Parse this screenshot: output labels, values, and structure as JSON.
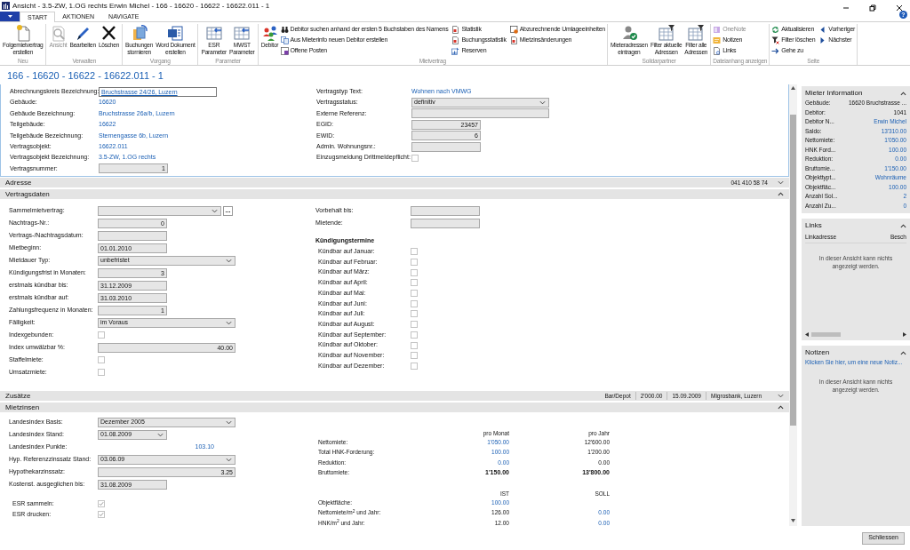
{
  "window": {
    "title": "Ansicht - 3.5-ZW, 1.OG rechts Erwin Michel - 166 - 16620 - 16622 - 16622.011 - 1",
    "help": "?"
  },
  "ribbon": {
    "tabs": [
      {
        "label": "START",
        "selected": true
      },
      {
        "label": "AKTIONEN",
        "selected": false
      },
      {
        "label": "NAVIGATE",
        "selected": false
      }
    ],
    "groups": [
      {
        "label": "Neu",
        "items": [
          {
            "label": "Folgemietvertrag\nerstellen",
            "kind": "large",
            "disabled": false
          }
        ]
      },
      {
        "label": "Verwalten",
        "items": [
          {
            "label": "Ansicht",
            "kind": "large",
            "disabled": true
          },
          {
            "label": "Bearbeiten",
            "kind": "large",
            "disabled": false
          },
          {
            "label": "Löschen",
            "kind": "large",
            "disabled": false
          }
        ]
      },
      {
        "label": "Vorgang",
        "items": [
          {
            "label": "Buchungen\nstornieren",
            "kind": "large",
            "disabled": false
          },
          {
            "label": "Word Dokument\nerstellen",
            "kind": "large",
            "disabled": false
          }
        ]
      },
      {
        "label": "Parameter",
        "items": [
          {
            "label": "ESR\nParameter",
            "kind": "large",
            "disabled": false
          },
          {
            "label": "MWST\nParameter",
            "kind": "large",
            "disabled": false
          }
        ]
      },
      {
        "label": "Mietvertrag",
        "items": [
          {
            "label": "Debitor",
            "kind": "large",
            "disabled": false
          },
          {
            "label": "Debitor suchen anhand der ersten 5 Buchstaben des Namens",
            "kind": "small",
            "disabled": false
          },
          {
            "label": "Aus Mieterinfo neuen Debitor erstellen",
            "kind": "small",
            "disabled": false
          },
          {
            "label": "Offene Posten",
            "kind": "small",
            "disabled": false
          },
          {
            "label": "Statistik",
            "kind": "small",
            "disabled": false
          },
          {
            "label": "Buchungsstatistik",
            "kind": "small",
            "disabled": false
          },
          {
            "label": "Reserven",
            "kind": "small",
            "disabled": false
          },
          {
            "label": "Abzurechnende Umlageeinheiten",
            "kind": "small",
            "disabled": false
          },
          {
            "label": "Mietzinsänderungen",
            "kind": "small",
            "disabled": false
          }
        ]
      },
      {
        "label": "Solidarpartner",
        "items": [
          {
            "label": "Mieteradressen\neintragen",
            "kind": "large",
            "disabled": false
          },
          {
            "label": "Filter aktuelle\nAdressen",
            "kind": "large",
            "disabled": false
          },
          {
            "label": "Filter alle\nAdressen",
            "kind": "large",
            "disabled": false
          }
        ]
      },
      {
        "label": "Dateianhang anzeigen",
        "items": [
          {
            "label": "OneNote",
            "kind": "small",
            "disabled": true
          },
          {
            "label": "Notizen",
            "kind": "small",
            "disabled": false
          },
          {
            "label": "Links",
            "kind": "small",
            "disabled": false
          }
        ]
      },
      {
        "label": "Seite",
        "items": [
          {
            "label": "Aktualisieren",
            "kind": "small",
            "disabled": false
          },
          {
            "label": "Filter löschen",
            "kind": "small",
            "disabled": false
          },
          {
            "label": "Gehe zu",
            "kind": "small",
            "disabled": false
          },
          {
            "label": "Vorheriger",
            "kind": "small",
            "disabled": false
          },
          {
            "label": "Nächster",
            "kind": "small",
            "disabled": false
          }
        ]
      }
    ]
  },
  "heading": "166 - 16620 - 16622 - 16622.011 - 1",
  "general": {
    "left": [
      {
        "label": "Abrechnungskreis Bezeichnung:",
        "kind": "link",
        "value": "Bruchstrasse 24/26, Luzern"
      },
      {
        "label": "Gebäude:",
        "kind": "value",
        "value": "16620"
      },
      {
        "label": "Gebäude Bezeichnung:",
        "kind": "value",
        "value": "Bruchstrasse 26a/b, Luzern"
      },
      {
        "label": "Teilgebäude:",
        "kind": "value",
        "value": "16622"
      },
      {
        "label": "Teilgebäude Bezeichnung:",
        "kind": "value",
        "value": "Sternengasse 6b, Luzern"
      },
      {
        "label": "Vertragsobjekt:",
        "kind": "value",
        "value": "16622.011"
      },
      {
        "label": "Vertragsobjekt Bezeichnung:",
        "kind": "value",
        "value": "3.5-ZW, 1.OG rechts"
      },
      {
        "label": "Vertragsnummer:",
        "kind": "number",
        "value": "1"
      }
    ],
    "right": [
      {
        "label": "Vertragstyp Text:",
        "kind": "value",
        "value": "Wohnen nach VMWG"
      },
      {
        "label": "Vertragsstatus:",
        "kind": "select",
        "value": "definitiv"
      },
      {
        "label": "Externe Referenz:",
        "kind": "wide-input"
      },
      {
        "label": "EGID:",
        "kind": "number",
        "value": "23457"
      },
      {
        "label": "EWID:",
        "kind": "number",
        "value": "6"
      },
      {
        "label": "Admin. Wohnungsnr.:",
        "kind": "input"
      },
      {
        "label": "Einzugsmeldung Drittmeldepflicht:",
        "kind": "checkbox",
        "checked": false
      }
    ]
  },
  "sections": [
    {
      "title": "Adresse",
      "expanded": false,
      "summary": [
        "041 410 58 74"
      ]
    },
    {
      "title": "Vertragsdaten",
      "expanded": true,
      "left": [
        {
          "label": "Sammelmietvertrag:",
          "kind": "picker",
          "button": "..."
        },
        {
          "label": "Nachtrags-Nr.:",
          "kind": "number",
          "value": "0"
        },
        {
          "label": "Vertrags-/Nachtragsdatum:",
          "kind": "input"
        },
        {
          "label": "Mietbeginn:",
          "kind": "input",
          "value": "01.01.2010"
        },
        {
          "label": "Mietdauer Typ:",
          "kind": "select",
          "value": "unbefristet"
        },
        {
          "label": "Kündigungsfrist in Monaten:",
          "kind": "number",
          "value": "3"
        },
        {
          "label": "erstmals kündbar bis:",
          "kind": "input",
          "value": "31.12.2009"
        },
        {
          "label": "erstmals kündbar auf:",
          "kind": "input",
          "value": "31.03.2010"
        },
        {
          "label": "Zahlungsfrequenz in Monaten:",
          "kind": "number",
          "value": "1"
        },
        {
          "label": "Fälligkeit:",
          "kind": "select",
          "value": "im Voraus"
        },
        {
          "label": "Indexgebunden:",
          "kind": "checkbox",
          "checked": false
        },
        {
          "label": "Index umwälzbar %:",
          "kind": "wide-number",
          "value": "40.00"
        },
        {
          "label": "Staffelmiete:",
          "kind": "checkbox",
          "checked": false
        },
        {
          "label": "Umsatzmiete:",
          "kind": "checkbox",
          "checked": false
        }
      ],
      "right": [
        {
          "label": "Vorbehalt bis:",
          "kind": "input"
        },
        {
          "label": "Mietende:",
          "kind": "input"
        }
      ],
      "termine_title": "Kündigungstermine",
      "termine": [
        {
          "label": "Kündbar auf Januar:",
          "checked": false
        },
        {
          "label": "Kündbar auf Februar:",
          "checked": false
        },
        {
          "label": "Kündbar auf März:",
          "checked": false
        },
        {
          "label": "Kündbar auf April:",
          "checked": false
        },
        {
          "label": "Kündbar auf Mai:",
          "checked": false
        },
        {
          "label": "Kündbar auf Juni:",
          "checked": false
        },
        {
          "label": "Kündbar auf Juli:",
          "checked": false
        },
        {
          "label": "Kündbar auf August:",
          "checked": false
        },
        {
          "label": "Kündbar auf September:",
          "checked": false
        },
        {
          "label": "Kündbar auf Oktober:",
          "checked": false
        },
        {
          "label": "Kündbar auf November:",
          "checked": false
        },
        {
          "label": "Kündbar auf Dezember:",
          "checked": false
        }
      ]
    },
    {
      "title": "Zusätze",
      "expanded": false,
      "summary": [
        "Bar/Depot",
        "2'000.00",
        "15.09.2009",
        "Migrosbank, Luzern"
      ]
    },
    {
      "title": "Mietzinsen",
      "expanded": true,
      "left": [
        {
          "label": "Landesindex Basis:",
          "kind": "select",
          "value": "Dezember 2005"
        },
        {
          "label": "Landesindex Stand:",
          "kind": "short-select",
          "value": "01.08.2009"
        },
        {
          "label": "Landesindex Punkte:",
          "kind": "value-right",
          "value": "103.10"
        },
        {
          "label": "Hyp. Referenzzinssatz Stand:",
          "kind": "select",
          "value": "03.06.09"
        },
        {
          "label": "Hypothekarzinssatz:",
          "kind": "wide-number",
          "value": "3.25"
        },
        {
          "label": "Kostenst. ausgeglichen bis:",
          "kind": "input",
          "value": "31.08.2009"
        }
      ],
      "esr": [
        {
          "label": "ESR sammeln:",
          "kind": "checkbox",
          "checked": true
        },
        {
          "label": "ESR drucken:",
          "kind": "checkbox",
          "checked": true
        }
      ],
      "tables": [
        {
          "columns": [
            "pro Monat",
            "pro Jahr"
          ],
          "rows": [
            {
              "label": "Nettomiete:",
              "total": false,
              "cells": [
                {
                  "text": "1'050.00",
                  "link": true
                },
                {
                  "text": "12'600.00",
                  "link": false
                }
              ]
            },
            {
              "label": "Total HNK-Forderung:",
              "total": false,
              "cells": [
                {
                  "text": "100.00",
                  "link": true
                },
                {
                  "text": "1'200.00",
                  "link": false
                }
              ]
            },
            {
              "label": "Reduktion:",
              "total": false,
              "cells": [
                {
                  "text": "0.00",
                  "link": true
                },
                {
                  "text": "0.00",
                  "link": false
                }
              ]
            },
            {
              "label": "Bruttomiete:",
              "total": true,
              "cells": [
                {
                  "text": "1'150.00",
                  "link": false
                },
                {
                  "text": "13'800.00",
                  "link": false
                }
              ]
            }
          ]
        },
        {
          "columns": [
            "IST",
            "SOLL"
          ],
          "rows": [
            {
              "label": "Objektfläche:",
              "total": false,
              "cells": [
                {
                  "text": "100.00",
                  "link": true
                }
              ]
            },
            {
              "label": "Nettomiete/m$^{2}$ und Jahr:",
              "total": false,
              "cells": [
                {
                  "text": "126.00",
                  "link": false
                },
                {
                  "text": "0.00",
                  "link": true
                }
              ]
            },
            {
              "label": "HNK/m$^{2}$ und Jahr:",
              "total": false,
              "cells": [
                {
                  "text": "12.00",
                  "link": false
                },
                {
                  "text": "0.00",
                  "link": true
                }
              ]
            }
          ]
        }
      ]
    }
  ],
  "panel": {
    "info": {
      "title": "Mieter Information",
      "rows": [
        {
          "label": "Gebäude:",
          "value": "16620 Bruchstrasse ...",
          "link": false
        },
        {
          "label": "Debitor:",
          "value": "1041",
          "link": false
        },
        {
          "label": "Debitor N...",
          "value": "Erwin Michel",
          "link": true
        },
        {
          "label": "Saldo:",
          "value": "13'310.00",
          "link": true
        },
        {
          "label": "Nettomiete:",
          "value": "1'050.00",
          "link": true
        },
        {
          "label": "HNK Ford...",
          "value": "100.00",
          "link": true
        },
        {
          "label": "Reduktion:",
          "value": "0.00",
          "link": true
        },
        {
          "label": "Bruttomie...",
          "value": "1'150.00",
          "link": true
        },
        {
          "label": "Objekttypt...",
          "value": "Wohnräume",
          "link": true
        },
        {
          "label": "Objektfläc...",
          "value": "100.00",
          "link": true
        },
        {
          "label": "Anzahl Sol...",
          "value": "2",
          "link": true
        },
        {
          "label": "Anzahl Zu...",
          "value": "0",
          "link": true
        }
      ]
    },
    "links": {
      "title": "Links",
      "columns": [
        "Linkadresse",
        "Besch"
      ],
      "empty": "In dieser Ansicht kann nichts angezeigt werden."
    },
    "notes": {
      "title": "Notizen",
      "new_link": "Klicken Sie hier, um eine neue Notiz...",
      "empty": "In dieser Ansicht kann nichts angezeigt werden."
    }
  },
  "footer": {
    "button": "Schliessen"
  }
}
